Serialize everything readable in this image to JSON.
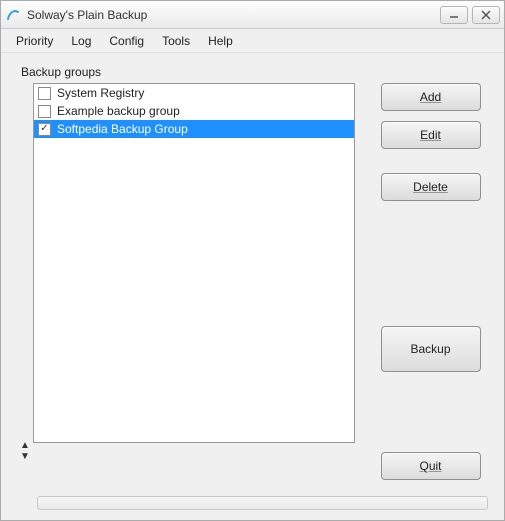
{
  "window": {
    "title": "Solway's Plain Backup"
  },
  "menu": {
    "items": [
      "Priority",
      "Log",
      "Config",
      "Tools",
      "Help"
    ]
  },
  "group_label": "Backup groups",
  "list": {
    "items": [
      {
        "label": "System Registry",
        "checked": false,
        "selected": false
      },
      {
        "label": "Example backup group",
        "checked": false,
        "selected": false
      },
      {
        "label": "Softpedia Backup Group",
        "checked": true,
        "selected": true
      }
    ]
  },
  "buttons": {
    "add": "Add",
    "edit": "Edit",
    "delete": "Delete",
    "backup": "Backup",
    "quit": "Quit"
  }
}
